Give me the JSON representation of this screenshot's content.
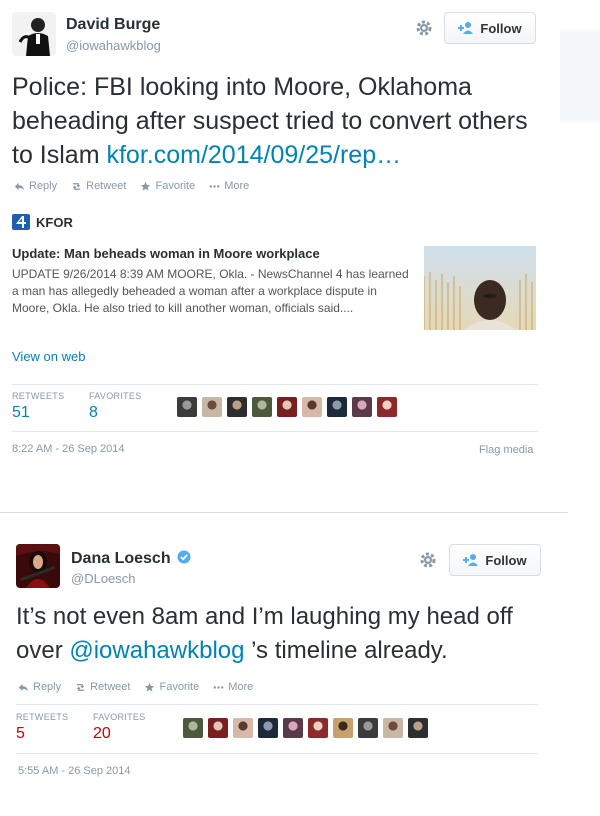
{
  "tweet1": {
    "display_name": "David Burge",
    "screen_name": "@iowahawkblog",
    "follow_label": "Follow",
    "text": "Police: FBI looking into Moore, Oklahoma beheading after suspect tried to convert others to Islam ",
    "link": "kfor.com/2014/09/25/rep…",
    "actions": {
      "reply": "Reply",
      "retweet": "Retweet",
      "favorite": "Favorite",
      "more": "More"
    },
    "card": {
      "brand": "KFOR",
      "title": "Update: Man beheads woman in Moore workplace",
      "description": "UPDATE 9/26/2014 8:39 AM MOORE, Okla. - NewsChannel 4 has learned a man has allegedly beheaded a woman after a workplace dispute in Moore, Okla. He also tried to kill another woman, officials said....",
      "view_label": "View on web"
    },
    "stats": {
      "retweets_label": "RETWEETS",
      "retweets": "51",
      "favorites_label": "FAVORITES",
      "favorites": "8"
    },
    "favoriter_avatars": 9,
    "timestamp": "8:22 AM - 26 Sep 2014",
    "flag_label": "Flag media"
  },
  "tweet2": {
    "display_name": "Dana Loesch",
    "screen_name": "@DLoesch",
    "follow_label": "Follow",
    "text_before": "It’s not even 8am and I’m laughing my head off over ",
    "mention": "@iowahawkblog",
    "text_after": " ’s timeline already.",
    "actions": {
      "reply": "Reply",
      "retweet": "Retweet",
      "favorite": "Favorite",
      "more": "More"
    },
    "stats": {
      "retweets_label": "RETWEETS",
      "retweets": "5",
      "favorites_label": "FAVORITES",
      "favorites": "20"
    },
    "favoriter_avatars": 10,
    "timestamp": "5:55 AM - 26 Sep 2014"
  },
  "colors": {
    "link": "#0084b4",
    "mention": "#e0245e",
    "muted": "#8899a6",
    "verified": "#55acee"
  }
}
